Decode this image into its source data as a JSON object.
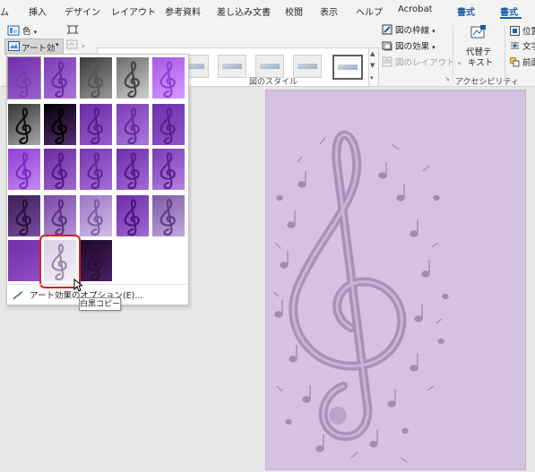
{
  "tabs": [
    {
      "label": "ム"
    },
    {
      "label": "挿入"
    },
    {
      "label": "デザイン"
    },
    {
      "label": "レイアウト"
    },
    {
      "label": "参考資料"
    },
    {
      "label": "差し込み文書"
    },
    {
      "label": "校閲"
    },
    {
      "label": "表示"
    },
    {
      "label": "ヘルプ"
    },
    {
      "label": "Acrobat"
    },
    {
      "label": "書式"
    },
    {
      "label": "書式"
    }
  ],
  "ribbon": {
    "color_label": "色",
    "art_effects_label": "アート効果",
    "picture_border_label": "図の枠線",
    "picture_effects_label": "図の効果",
    "picture_layout_label": "図のレイアウト",
    "picture_styles_group": "図のスタイル",
    "alt_text_label_line1": "代替テ",
    "alt_text_label_line2": "キスト",
    "accessibility_group": "アクセシビリティ",
    "position_label": "位置",
    "wrap_text_label": "文字",
    "bring_forward_label": "前面"
  },
  "art_effects_menu": {
    "options_link": "アート効果のオプション(E)...",
    "tooltip": "白黒コピー",
    "selected_effect": "白黒コピー",
    "effect_count": 23
  },
  "colors": {
    "accent": "#1e5fa8",
    "highlight_frame": "#d81e1e",
    "page_background": "#d4c2e0",
    "effect_purple": "#6f2da8"
  },
  "icons": {
    "color": "color-palette-icon",
    "art_effects": "art-effects-icon",
    "compress": "compress-pictures-icon",
    "options": "brush-icon",
    "treble_clef": "treble-clef-icon"
  }
}
